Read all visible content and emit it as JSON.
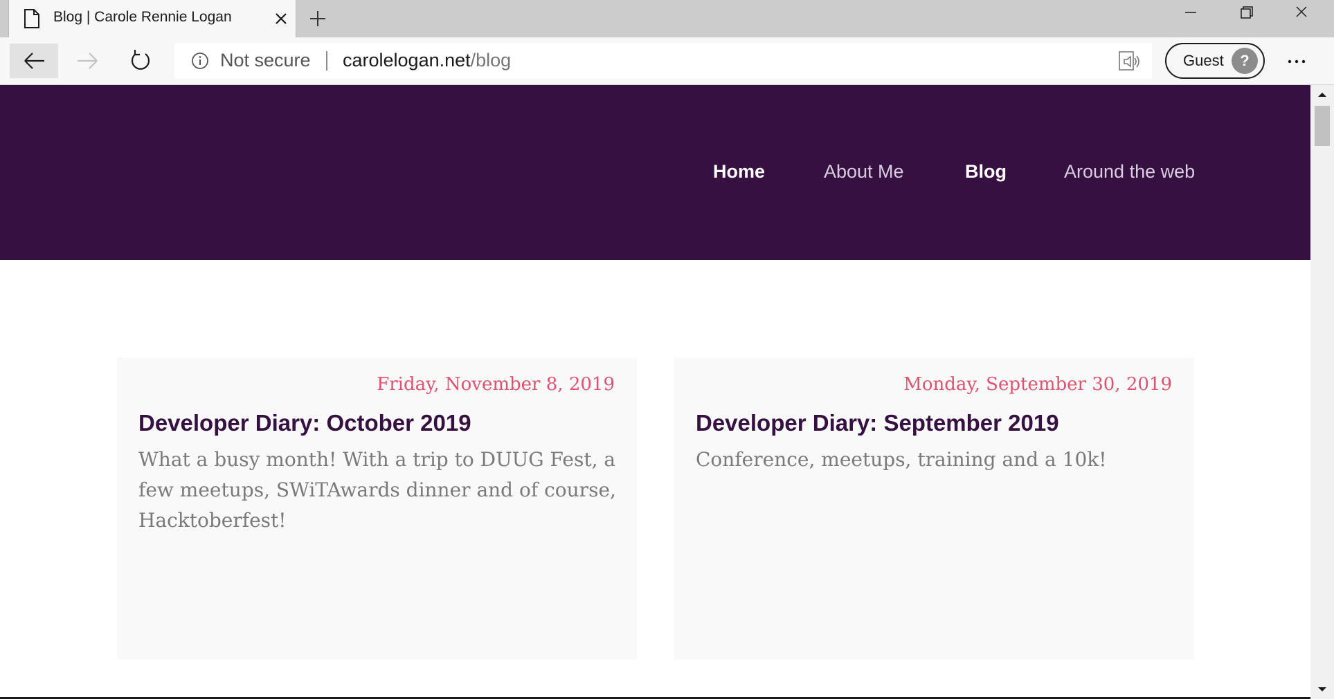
{
  "browser": {
    "tab_title": "Blog | Carole Rennie Logan",
    "security_label": "Not secure",
    "url_host": "carolelogan.net",
    "url_path": "/blog",
    "profile_label": "Guest",
    "profile_avatar_glyph": "?"
  },
  "site": {
    "header_color": "#351040",
    "nav": [
      {
        "label": "Home",
        "active": true
      },
      {
        "label": "About Me",
        "active": false
      },
      {
        "label": "Blog",
        "active": true
      },
      {
        "label": "Around the web",
        "active": false
      }
    ]
  },
  "posts": [
    {
      "date": "Friday, November 8, 2019",
      "title": "Developer Diary: October 2019",
      "excerpt": "What a busy month! With a trip to DUUG Fest, a few meetups, SWiTAwards dinner and of course, Hacktoberfest!"
    },
    {
      "date": "Monday, September 30, 2019",
      "title": "Developer Diary: September 2019",
      "excerpt": "Conference, meetups, training and a 10k!"
    }
  ],
  "colors": {
    "date": "#e05270",
    "title": "#351040",
    "excerpt": "#7a7a7a"
  }
}
